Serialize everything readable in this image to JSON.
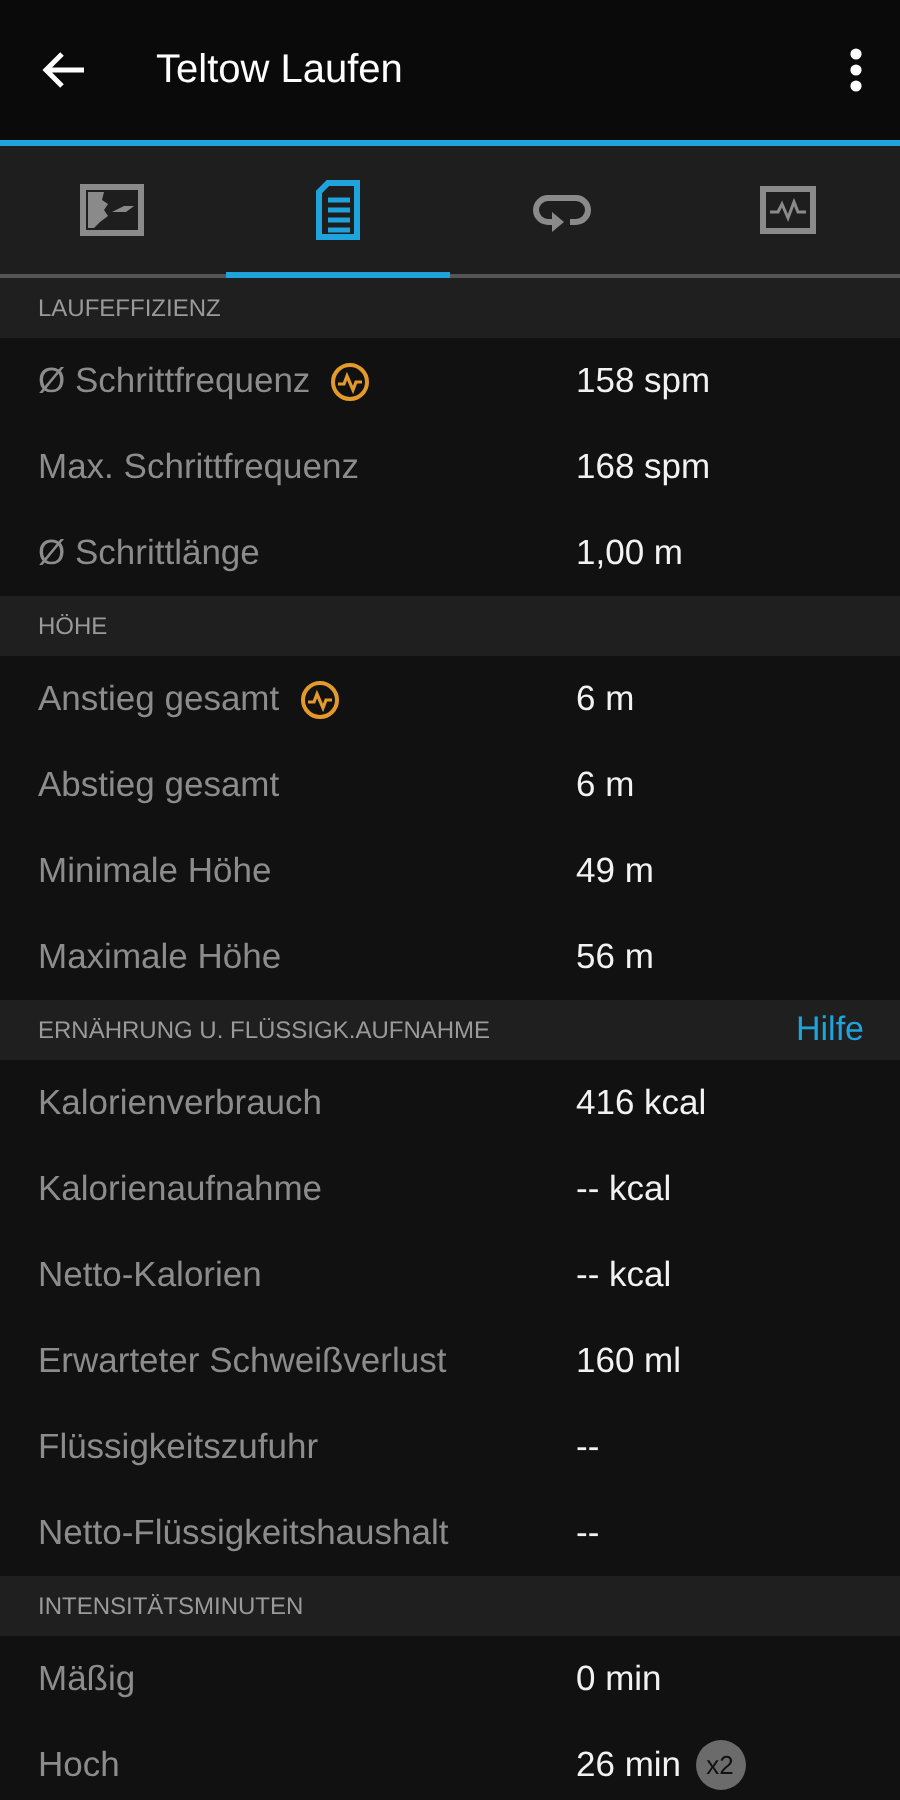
{
  "header": {
    "title": "Teltow Laufen"
  },
  "tabs": [
    {
      "selected": false
    },
    {
      "selected": true
    },
    {
      "selected": false
    },
    {
      "selected": false
    }
  ],
  "sections": [
    {
      "title": "LAUFEFFIZIENZ",
      "rows": [
        {
          "label": "Ø Schrittfrequenz",
          "value": "158 spm",
          "chart_icon": true
        },
        {
          "label": "Max. Schrittfrequenz",
          "value": "168 spm",
          "chart_icon": false
        },
        {
          "label": "Ø Schrittlänge",
          "value": "1,00 m",
          "chart_icon": false
        }
      ]
    },
    {
      "title": "HÖHE",
      "rows": [
        {
          "label": "Anstieg gesamt",
          "value": "6 m",
          "chart_icon": true
        },
        {
          "label": "Abstieg gesamt",
          "value": "6 m",
          "chart_icon": false
        },
        {
          "label": "Minimale Höhe",
          "value": "49 m",
          "chart_icon": false
        },
        {
          "label": "Maximale Höhe",
          "value": "56 m",
          "chart_icon": false
        }
      ]
    },
    {
      "title": "ERNÄHRUNG U. FLÜSSIGK.AUFNAHME",
      "link": "Hilfe",
      "rows": [
        {
          "label": "Kalorienverbrauch",
          "value": "416 kcal",
          "chart_icon": false
        },
        {
          "label": "Kalorienaufnahme",
          "value": "-- kcal",
          "chart_icon": false
        },
        {
          "label": "Netto-Kalorien",
          "value": "-- kcal",
          "chart_icon": false
        },
        {
          "label": "Erwarteter Schweißverlust",
          "value": "160 ml",
          "chart_icon": false
        },
        {
          "label": "Flüssigkeitszufuhr",
          "value": "--",
          "chart_icon": false
        },
        {
          "label": "Netto-Flüssigkeitshaushalt",
          "value": "--",
          "chart_icon": false
        }
      ]
    },
    {
      "title": "INTENSITÄTSMINUTEN",
      "rows": [
        {
          "label": "Mäßig",
          "value": "0 min",
          "chart_icon": false
        },
        {
          "label": "Hoch",
          "value": "26 min",
          "chart_icon": false,
          "badge": "x2"
        }
      ]
    }
  ]
}
